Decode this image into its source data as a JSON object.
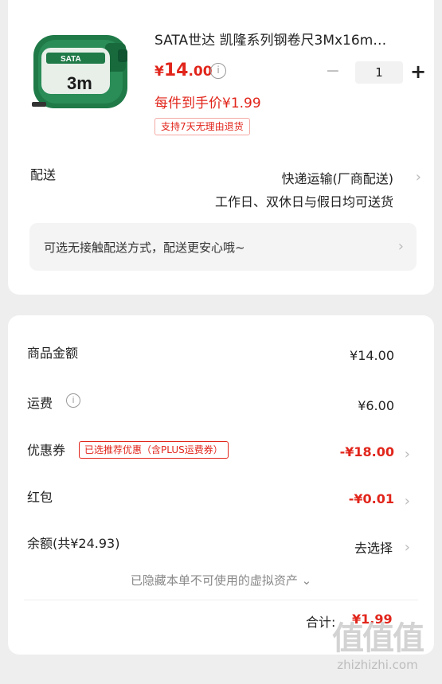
{
  "product": {
    "image_label": "SATA",
    "image_size": "3m",
    "title": "SATA世达 凯隆系列钢卷尺3Mx16m…",
    "price_currency": "¥",
    "price_int": "14",
    "price_dec": ".00",
    "info_icon": "i",
    "qty_minus": "−",
    "quantity": "1",
    "qty_plus": "+",
    "unit_price": "每件到手价¥1.99",
    "return_tag": "支持7天无理由退货"
  },
  "delivery": {
    "label": "配送",
    "method": "快递运输(厂商配送)",
    "time": "工作日、双休日与假日均可送货",
    "notice": "可选无接触配送方式，配送更安心哦~",
    "chevron": "›"
  },
  "summary": {
    "goods_label": "商品金额",
    "goods_value": "¥14.00",
    "shipping_label": "运费",
    "shipping_info": "i",
    "shipping_value": "¥6.00",
    "coupon_label": "优惠券",
    "coupon_tag": "已选推荐优惠（含PLUS运费券）",
    "coupon_value": "-¥18.00",
    "redpacket_label": "红包",
    "redpacket_value": "-¥0.01",
    "balance_label": "余额(共¥24.93)",
    "balance_value": "去选择",
    "hidden_assets": "已隐藏本单不可使用的虚拟资产 ⌄",
    "total_label": "合计:",
    "total_value": "¥1.99"
  },
  "watermark": {
    "mark": "值值值",
    "url": "zhizhizhi.com"
  },
  "colors": {
    "accent": "#e1251b",
    "background": "#eeeeee",
    "card": "#ffffff"
  }
}
